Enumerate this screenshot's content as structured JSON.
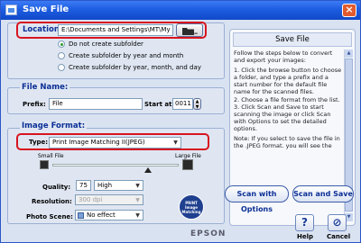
{
  "window": {
    "title": "Save File"
  },
  "location": {
    "label": "Location:",
    "path": "E:\\Documents and Settings\\MT\\My Doc",
    "browse_button_label": "...",
    "subfolder_options": [
      {
        "label": "Do not create subfolder",
        "selected": true
      },
      {
        "label": "Create subfolder by year and month",
        "selected": false
      },
      {
        "label": "Create subfolder by year, month, and day",
        "selected": false
      }
    ]
  },
  "file_name": {
    "group_title": "File Name:",
    "prefix_label": "Prefix:",
    "prefix_value": "File",
    "start_at_label": "Start at:",
    "start_at_value": "0011"
  },
  "image_format": {
    "group_title": "Image Format:",
    "type_label": "Type:",
    "type_value": "Print Image Matching II(JPEG)",
    "small_file_label": "Small File",
    "large_file_label": "Large File",
    "quality_label": "Quality:",
    "quality_value": "75",
    "quality_preset": "High",
    "resolution_label": "Resolution:",
    "resolution_value": "300 dpi",
    "photo_scene_label": "Photo Scene:",
    "photo_scene_value": "No effect",
    "pim_badge_line1": "PRINT",
    "pim_badge_line2": "Image",
    "pim_badge_line3": "Matching"
  },
  "help_panel": {
    "heading": "Save File",
    "paragraphs": [
      "Follow the steps below to convert and export your images:",
      "1. Click the browse button to choose a folder, and type a prefix and a start number for the default file name for the scanned files.\n2. Choose a file format from the list.\n3. Click Scan and Save to start scanning the image or click Scan with Options to set the detailed options.",
      "Note: If you select to save the file in the .JPEG format. you will see the"
    ]
  },
  "actions": {
    "scan_with_options": "Scan with Options",
    "scan_and_save": "Scan and Save"
  },
  "footer": {
    "brand": "EPSON",
    "help_label": "Help",
    "cancel_label": "Cancel",
    "help_glyph": "?",
    "cancel_glyph": "⊘"
  },
  "colors": {
    "accent_red": "#d8141e",
    "group_title_blue": "#0b2f96",
    "titlebar_blue": "#1d5de0"
  }
}
